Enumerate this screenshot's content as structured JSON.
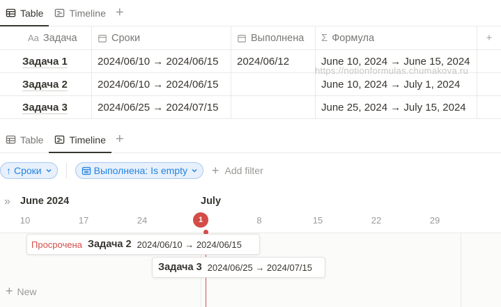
{
  "tabs_top": [
    {
      "label": "Table",
      "icon": "table-icon"
    },
    {
      "label": "Timeline",
      "icon": "timeline-icon"
    }
  ],
  "table": {
    "columns": [
      {
        "label": "Задача",
        "icon": "Aa"
      },
      {
        "label": "Сроки",
        "icon": "calendar-icon"
      },
      {
        "label": "Выполнена",
        "icon": "calendar-icon"
      },
      {
        "label": "Формула",
        "icon": "Σ"
      }
    ],
    "add_column_icon": "+",
    "rows": [
      {
        "task": "Задача 1",
        "dates": "2024/06/10 → 2024/06/15",
        "done": "2024/06/12",
        "formula": "June 10, 2024 → June 15, 2024"
      },
      {
        "task": "Задача 2",
        "dates": "2024/06/10 → 2024/06/15",
        "done": "",
        "formula": "June 10, 2024 → July 1, 2024"
      },
      {
        "task": "Задача 3",
        "dates": "2024/06/25 → 2024/07/15",
        "done": "",
        "formula": "June 25, 2024 → July 15, 2024"
      }
    ]
  },
  "watermark": "https://notionformulas.chumakova.ru",
  "tabs_bottom": [
    {
      "label": "Table",
      "icon": "table-icon"
    },
    {
      "label": "Timeline",
      "icon": "timeline-icon"
    }
  ],
  "filters": {
    "sort_label": "Сроки",
    "filter_label": "Выполнена: Is empty",
    "add_filter_label": "Add filter"
  },
  "timeline": {
    "month_left": "June 2024",
    "month_right": "July",
    "days": [
      "10",
      "17",
      "24",
      "1",
      "8",
      "15",
      "22",
      "29"
    ],
    "today": "1",
    "accent_color": "#d44c47",
    "items": [
      {
        "status": "Просрочена",
        "title": "Задача 2",
        "dates": "2024/06/10 → 2024/06/15"
      },
      {
        "status": "",
        "title": "Задача 3",
        "dates": "2024/06/25 → 2024/07/15"
      }
    ],
    "new_label": "New"
  },
  "colors": {
    "accent_blue": "#2383e2",
    "overdue_red": "#d44c47"
  }
}
